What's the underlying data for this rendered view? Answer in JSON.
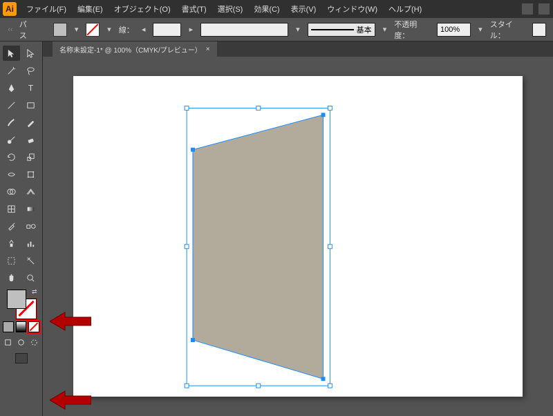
{
  "menu": {
    "file": "ファイル(F)",
    "edit": "編集(E)",
    "object": "オブジェクト(O)",
    "format": "書式(T)",
    "select": "選択(S)",
    "effect": "効果(C)",
    "view": "表示(V)",
    "window": "ウィンドウ(W)",
    "help": "ヘルプ(H)"
  },
  "control": {
    "path": "パス",
    "stroke_label": "線：",
    "basic": "基本",
    "opacity_label": "不透明度：",
    "opacity_value": "100%",
    "style_label": "スタイル："
  },
  "tab": {
    "title": "名称未設定-1* @ 100%（CMYK/プレビュー）",
    "close": "×"
  },
  "colors": {
    "shape_fill": "#b2ab9c",
    "selection": "#1a8cff",
    "arrow": "#b50000"
  }
}
